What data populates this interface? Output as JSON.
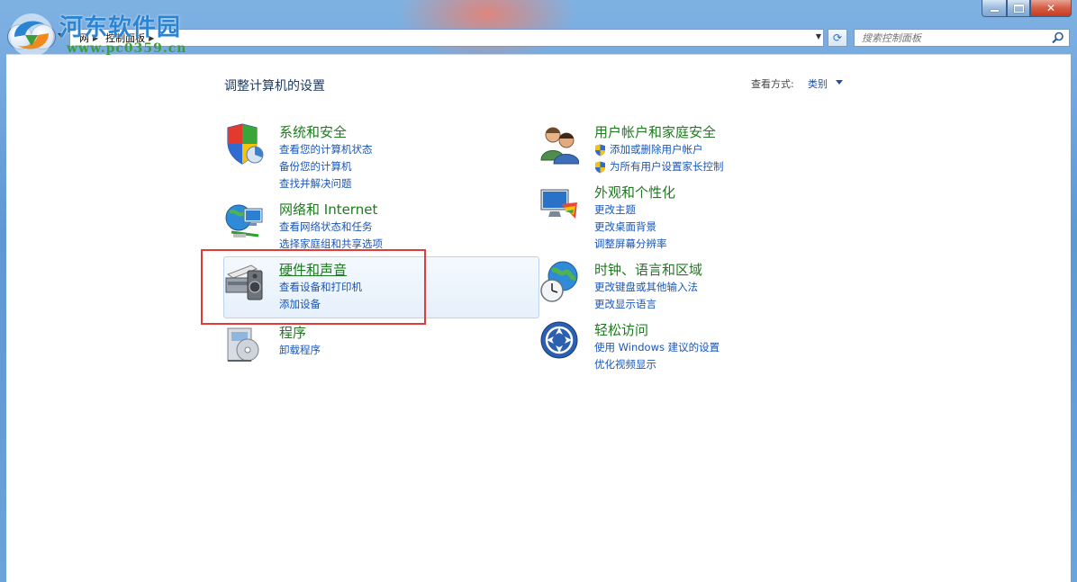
{
  "address": {
    "crumbs": [
      "网",
      "控制面板"
    ],
    "search_placeholder": "搜索控制面板"
  },
  "header": {
    "title": "调整计算机的设置",
    "view_by_label": "查看方式:",
    "view_by_value": "类别"
  },
  "categories": {
    "system": {
      "title": "系统和安全",
      "links": [
        "查看您的计算机状态",
        "备份您的计算机",
        "查找并解决问题"
      ]
    },
    "network": {
      "title": "网络和 Internet",
      "links": [
        "查看网络状态和任务",
        "选择家庭组和共享选项"
      ]
    },
    "hardware": {
      "title": "硬件和声音",
      "links": [
        "查看设备和打印机",
        "添加设备"
      ]
    },
    "programs": {
      "title": "程序",
      "links": [
        "卸载程序"
      ]
    },
    "users": {
      "title": "用户帐户和家庭安全",
      "links": [
        "添加或删除用户帐户",
        "为所有用户设置家长控制"
      ]
    },
    "appearance": {
      "title": "外观和个性化",
      "links": [
        "更改主题",
        "更改桌面背景",
        "调整屏幕分辨率"
      ]
    },
    "clock": {
      "title": "时钟、语言和区域",
      "links": [
        "更改键盘或其他输入法",
        "更改显示语言"
      ]
    },
    "ease": {
      "title": "轻松访问",
      "links": [
        "使用 Windows 建议的设置",
        "优化视频显示"
      ]
    }
  },
  "watermark": {
    "name": "河东软件园",
    "url": "www.pc0359.cn"
  },
  "colors": {
    "category_title": "#1f7a1f",
    "link": "#1a56b8",
    "highlight_frame": "#e03c3c"
  }
}
